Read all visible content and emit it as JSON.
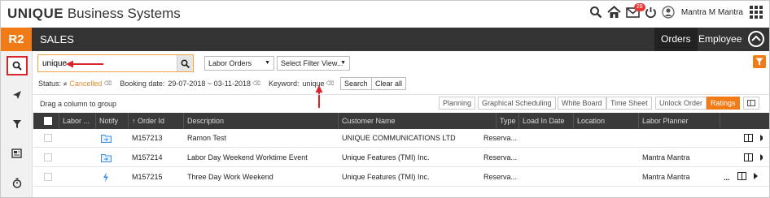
{
  "header": {
    "brand_bold": "UNIQUE",
    "brand_rest": " Business Systems",
    "notification_count": "28",
    "user_name": "Mantra M Mantra"
  },
  "bar": {
    "logo": "R2",
    "title": "SALES",
    "tabs": [
      "Orders",
      "Employee"
    ]
  },
  "search": {
    "value": "unique"
  },
  "filters": {
    "labor_orders": "Labor Orders",
    "filter_view": "Select Filter View..."
  },
  "status_row": {
    "status_label": "Status:",
    "status_value": "Cancelled",
    "booking_label": "Booking date:",
    "booking_value": "29-07-2018 ~ 03-11-2018",
    "keyword_label": "Keyword:",
    "keyword_value": "unique",
    "search_btn": "Search",
    "clear_btn": "Clear all"
  },
  "grid_toolbar": {
    "drag_label": "Drag a column to group",
    "buttons": [
      "Planning",
      "Graphical Scheduling",
      "White Board",
      "Time Sheet",
      "Unlock Order",
      "Ratings"
    ]
  },
  "columns": [
    "Labor ...",
    "Notify",
    "Order Id",
    "Description",
    "Customer Name",
    "Type",
    "Load In Date",
    "Location",
    "Labor Planner"
  ],
  "rows": [
    {
      "order_id": "M157213",
      "description": "Ramon Test",
      "customer": "UNIQUE COMMUNICATIONS LTD",
      "type": "Reserva...",
      "load_in": "",
      "location": "",
      "planner": "",
      "notify_icon": "folder-icon",
      "more": ""
    },
    {
      "order_id": "M157214",
      "description": "Labor Day Weekend Worktime Event",
      "customer": "Unique Features (TMI) Inc.",
      "type": "Reserva...",
      "load_in": "",
      "location": "",
      "planner": "Mantra Mantra",
      "notify_icon": "folder-icon",
      "more": ""
    },
    {
      "order_id": "M157215",
      "description": "Three Day Work Weekend",
      "customer": "Unique Features (TMI) Inc.",
      "type": "Reserva...",
      "load_in": "",
      "location": "",
      "planner": "Mantra Mantra",
      "notify_icon": "lightning-icon",
      "more": "..."
    }
  ],
  "colors": {
    "accent": "#f07b17",
    "dark": "#333333",
    "annotation": "#d9232d"
  }
}
